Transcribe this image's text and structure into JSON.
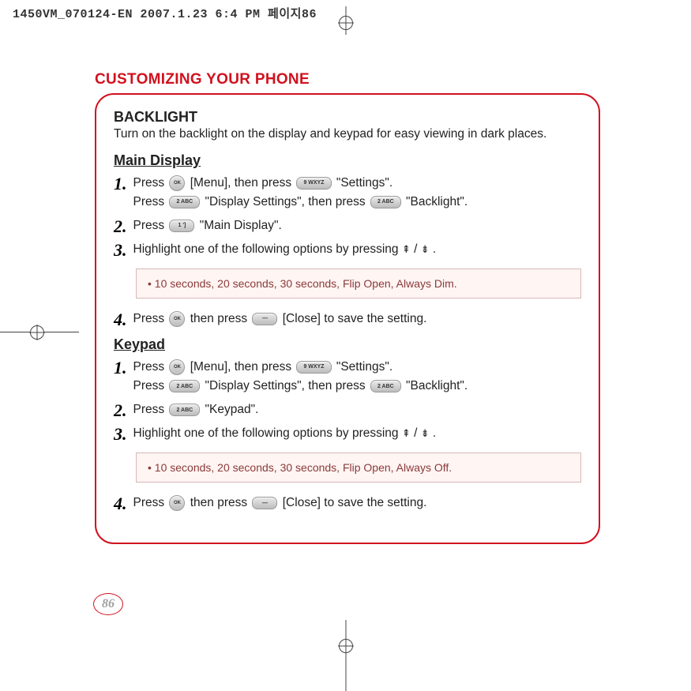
{
  "print_header": "1450VM_070124-EN  2007.1.23 6:4 PM  페이지86",
  "section_title": "CUSTOMIZING YOUR PHONE",
  "heading": "BACKLIGHT",
  "intro": "Turn on the backlight on the display and keypad for easy viewing in dark places.",
  "main_display": {
    "title": "Main Display",
    "steps": {
      "s1a": "Press ",
      "s1b": " [Menu], then press ",
      "s1c": " \"Settings\".",
      "s1d": "Press ",
      "s1e": " \"Display Settings\", then press ",
      "s1f": " \"Backlight\".",
      "s2a": "Press ",
      "s2b": " \"Main Display\".",
      "s3a": "Highlight one of the following options by pressing ",
      "s3b": " / ",
      "s3c": " .",
      "note": "10 seconds, 20 seconds, 30 seconds, Flip Open, Always Dim.",
      "s4a": "Press ",
      "s4b": " then press ",
      "s4c": " [Close] to save the setting."
    }
  },
  "keypad": {
    "title": "Keypad",
    "steps": {
      "s1a": "Press ",
      "s1b": " [Menu], then press ",
      "s1c": " \"Settings\".",
      "s1d": "Press ",
      "s1e": " \"Display Settings\", then press ",
      "s1f": " \"Backlight\".",
      "s2a": "Press ",
      "s2b": " \"Keypad\".",
      "s3a": "Highlight one of the following options by pressing ",
      "s3b": " / ",
      "s3c": " .",
      "note": "10 seconds, 20 seconds, 30 seconds, Flip Open, Always Off.",
      "s4a": "Press ",
      "s4b": " then press ",
      "s4c": " [Close] to save the setting."
    }
  },
  "page_number": "86",
  "keys": {
    "ok": "OK",
    "k9": "9 WXYZ",
    "k2": "2 ABC",
    "k1": "1 ']",
    "dash": "—"
  },
  "nums": {
    "n1": "1.",
    "n2": "2.",
    "n3": "3.",
    "n4": "4."
  }
}
